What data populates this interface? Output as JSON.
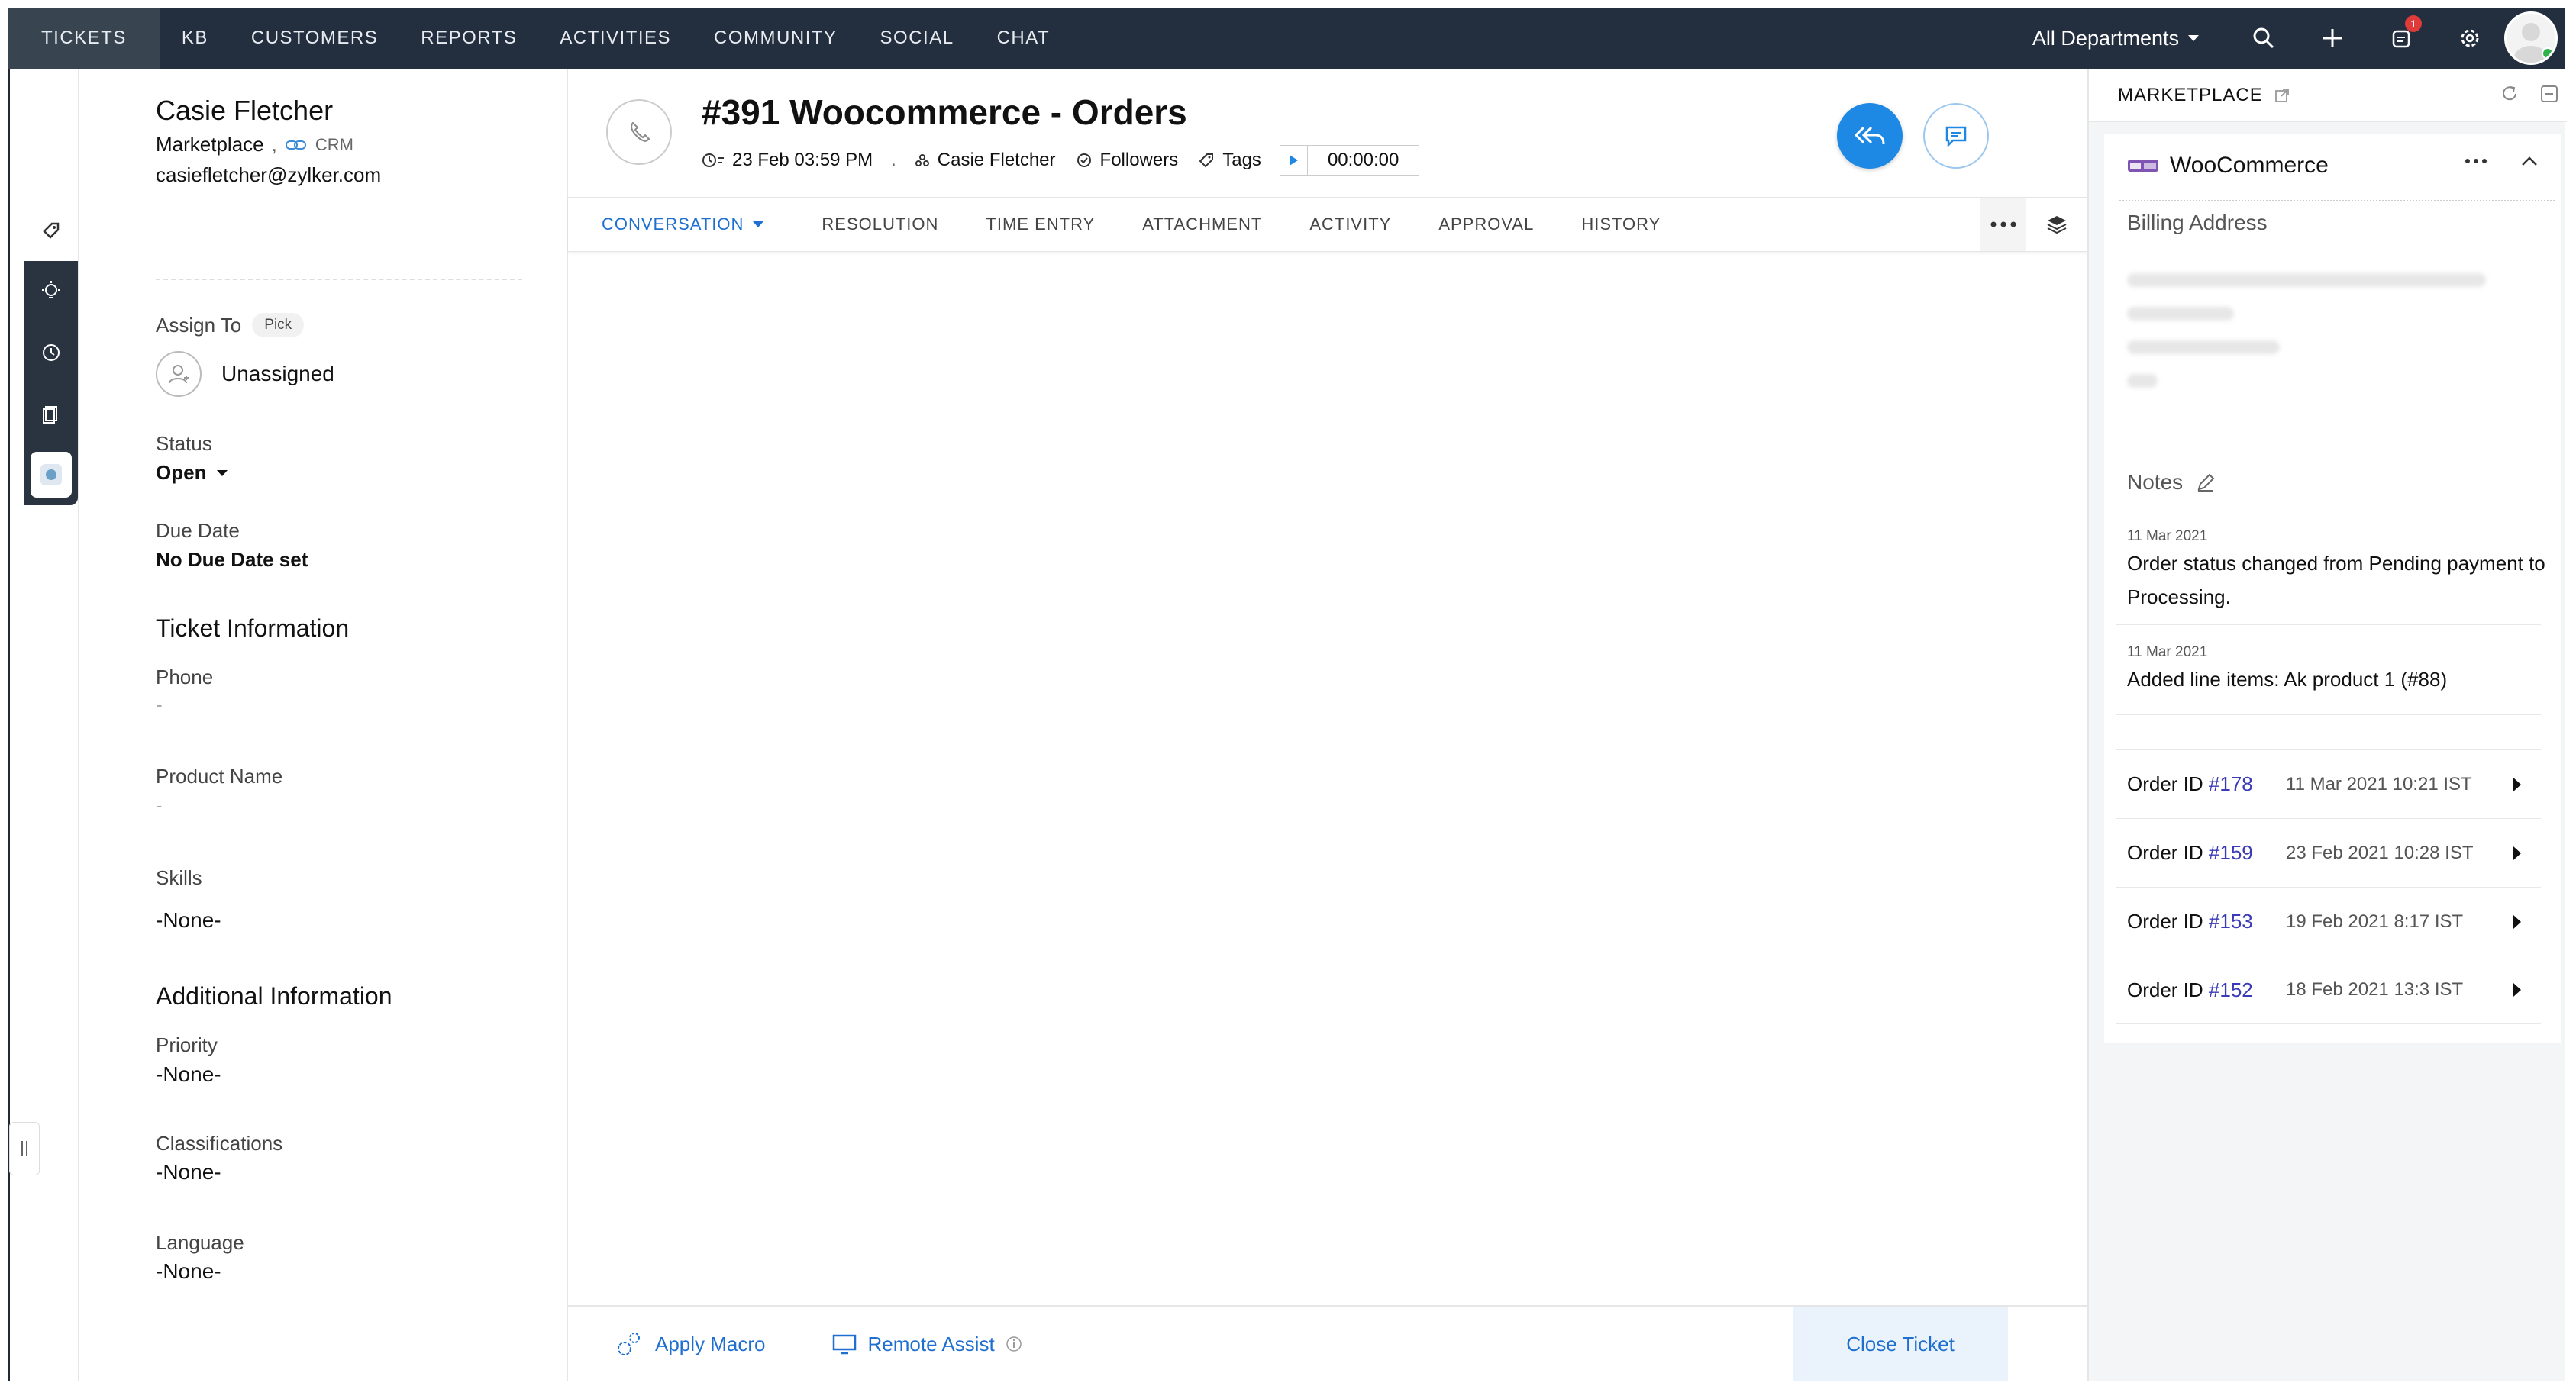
{
  "nav": {
    "tabs": [
      "TICKETS",
      "KB",
      "CUSTOMERS",
      "REPORTS",
      "ACTIVITIES",
      "COMMUNITY",
      "SOCIAL",
      "CHAT"
    ],
    "department": "All Departments",
    "notification_count": "1"
  },
  "contact": {
    "name": "Casie Fletcher",
    "account": "Marketplace",
    "account_suffix": ",",
    "crm_label": "CRM",
    "email": "casiefletcher@zylker.com"
  },
  "properties": {
    "assign_label": "Assign To",
    "pick_label": "Pick",
    "assignee": "Unassigned",
    "status_label": "Status",
    "status_value": "Open",
    "due_label": "Due Date",
    "due_value": "No Due Date set"
  },
  "ticket_info": {
    "title": "Ticket Information",
    "phone_label": "Phone",
    "phone_value": "-",
    "product_label": "Product Name",
    "product_value": "-",
    "skills_label": "Skills",
    "skills_value": "-None-"
  },
  "additional_info": {
    "title": "Additional Information",
    "priority_label": "Priority",
    "priority_value": "-None-",
    "class_label": "Classifications",
    "class_value": "-None-",
    "lang_label": "Language",
    "lang_value": "-None-"
  },
  "ticket": {
    "title": "#391  Woocommerce - Orders",
    "date": "23 Feb 03:59 PM",
    "dot": ".",
    "contact": "Casie Fletcher",
    "followers_label": "Followers",
    "tags_label": "Tags",
    "timer": "00:00:00"
  },
  "tabs": [
    "CONVERSATION",
    "RESOLUTION",
    "TIME ENTRY",
    "ATTACHMENT",
    "ACTIVITY",
    "APPROVAL",
    "HISTORY"
  ],
  "bottom": {
    "apply_macro": "Apply Macro",
    "remote_assist": "Remote Assist",
    "close_ticket": "Close Ticket"
  },
  "marketplace": {
    "header": "MARKETPLACE",
    "app_name": "WooCommerce",
    "billing_title": "Billing Address",
    "notes_title": "Notes",
    "notes": [
      {
        "date": "11 Mar 2021",
        "text": "Order status changed from Pending payment to Processing."
      },
      {
        "date": "11 Mar 2021",
        "text": "Added line items: Ak product 1 (#88)"
      }
    ],
    "orders": [
      {
        "label": "Order ID ",
        "id": "#178",
        "date": "11 Mar 2021 10:21 IST"
      },
      {
        "label": "Order ID ",
        "id": "#159",
        "date": "23 Feb 2021 10:28 IST"
      },
      {
        "label": "Order ID ",
        "id": "#153",
        "date": "19 Feb 2021 8:17 IST"
      },
      {
        "label": "Order ID ",
        "id": "#152",
        "date": "18 Feb 2021 13:3 IST"
      }
    ]
  },
  "colors": {
    "nav_bg": "#232f3e",
    "accent": "#1e88e5",
    "link": "#1e6fd0"
  }
}
